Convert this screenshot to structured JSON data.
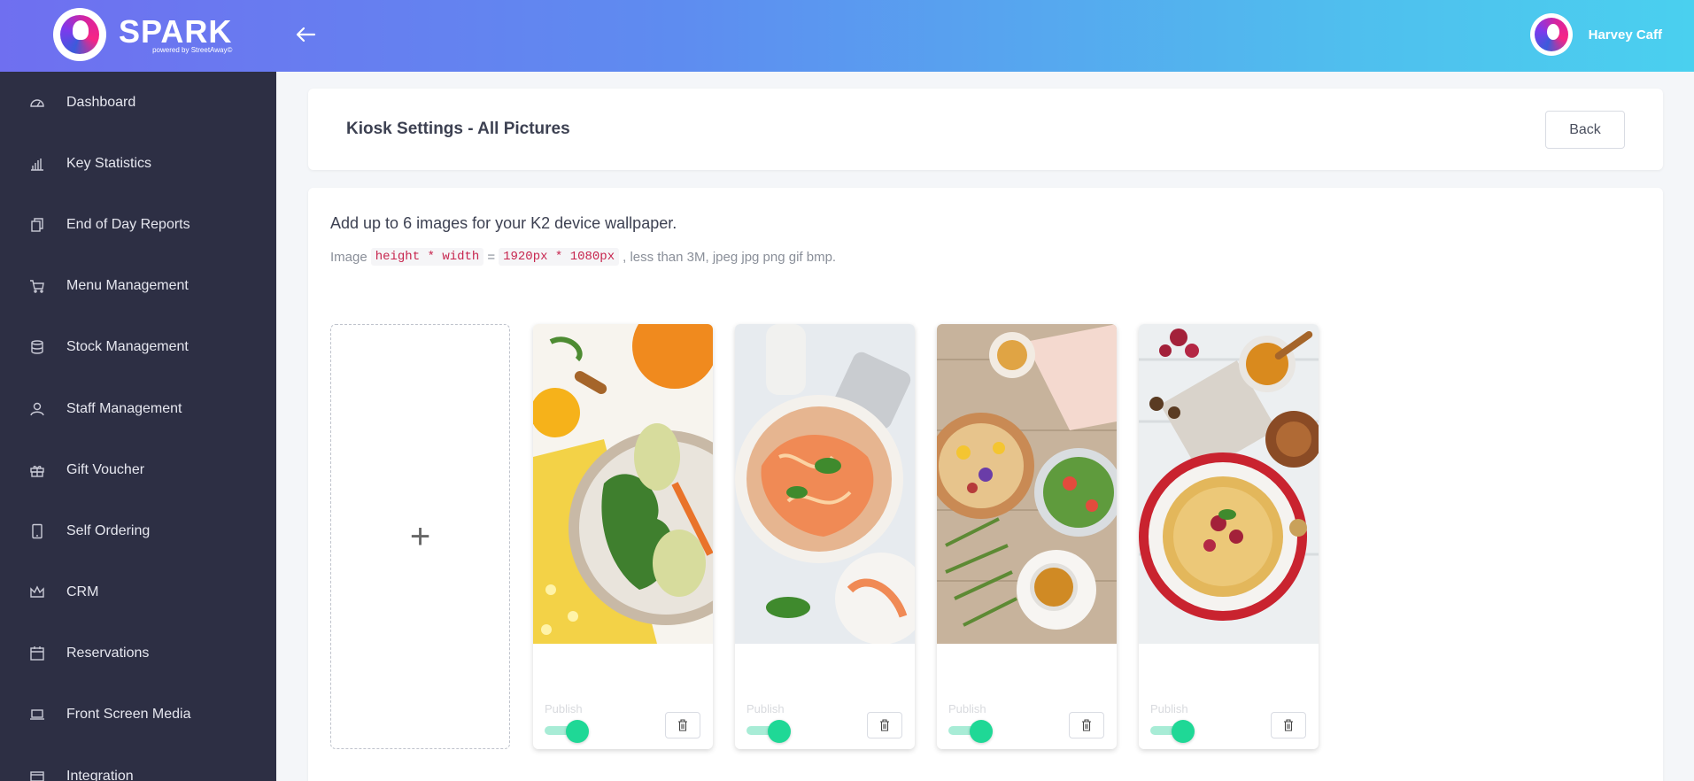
{
  "app": {
    "brand": "SPARK",
    "brand_sub": "powered by StreetAway©",
    "user_name": "Harvey Caff"
  },
  "sidebar": {
    "items": [
      {
        "label": "Dashboard",
        "icon": "dashboard-icon"
      },
      {
        "label": "Key Statistics",
        "icon": "bar-chart-icon"
      },
      {
        "label": "End of Day Reports",
        "icon": "documents-icon"
      },
      {
        "label": "Menu Management",
        "icon": "cart-icon"
      },
      {
        "label": "Stock Management",
        "icon": "database-icon"
      },
      {
        "label": "Staff Management",
        "icon": "person-icon"
      },
      {
        "label": "Gift Voucher",
        "icon": "gift-icon"
      },
      {
        "label": "Self Ordering",
        "icon": "tablet-icon"
      },
      {
        "label": "CRM",
        "icon": "crown-icon"
      },
      {
        "label": "Reservations",
        "icon": "calendar-icon"
      },
      {
        "label": "Front Screen Media",
        "icon": "laptop-icon"
      },
      {
        "label": "Integration",
        "icon": "integration-icon"
      }
    ]
  },
  "page": {
    "title": "Kiosk Settings - All Pictures",
    "back_label": "Back",
    "intro": "Add up to 6 images for your K2 device wallpaper.",
    "spec_prefix": "Image",
    "spec_code1": "height * width",
    "spec_eq": "=",
    "spec_code2": "1920px * 1080px",
    "spec_suffix": ", less than 3M, jpeg jpg png gif bmp.",
    "add_symbol": "+"
  },
  "pictures": [
    {
      "label": "Publish",
      "published": true,
      "image": "pear-salad-image"
    },
    {
      "label": "Publish",
      "published": true,
      "image": "pasta-bowl-image"
    },
    {
      "label": "Publish",
      "published": true,
      "image": "tea-and-salad-image"
    },
    {
      "label": "Publish",
      "published": true,
      "image": "pancakes-and-honey-image"
    }
  ]
}
